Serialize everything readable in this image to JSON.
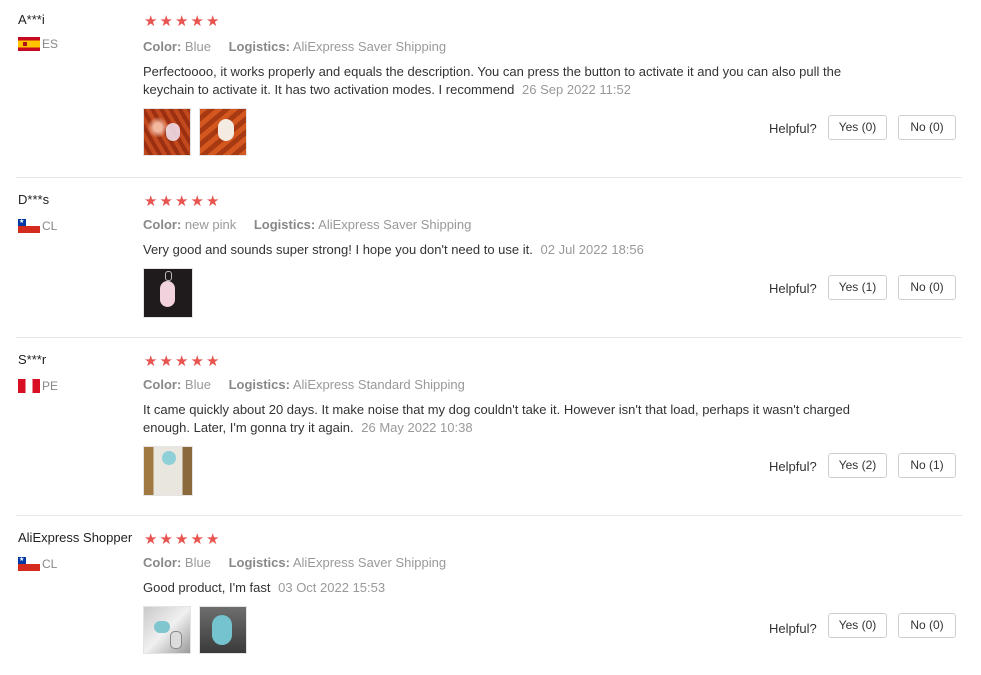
{
  "labels": {
    "color": "Color:",
    "logistics": "Logistics:",
    "helpful": "Helpful?"
  },
  "reviews": [
    {
      "name": "A***i",
      "country": "ES",
      "flag": "spain-flag-icon",
      "rating": 5,
      "color": "Blue",
      "logistics": "AliExpress Saver Shipping",
      "text": "Perfectoooo, it works properly and equals the description. You can press the button to activate it and you can also pull the keychain to activate it. It has two activation modes. I recommend",
      "date": "26 Sep 2022 11:52",
      "yes": "Yes (0)",
      "no": "No (0)"
    },
    {
      "name": "D***s",
      "country": "CL",
      "flag": "chile-flag-icon",
      "rating": 5,
      "color": "new pink",
      "logistics": "AliExpress Saver Shipping",
      "text": "Very good and sounds super strong! I hope you don't need to use it.",
      "date": "02 Jul 2022 18:56",
      "yes": "Yes (1)",
      "no": "No (0)"
    },
    {
      "name": "S***r",
      "country": "PE",
      "flag": "peru-flag-icon",
      "rating": 5,
      "color": "Blue",
      "logistics": "AliExpress Standard Shipping",
      "text": "It came quickly about 20 days. It make noise that my dog couldn't take it. However isn't that load, perhaps it wasn't charged enough. Later, I'm gonna try it again.",
      "date": "26 May 2022 10:38",
      "yes": "Yes (2)",
      "no": "No (1)"
    },
    {
      "name": "AliExpress Shopper",
      "country": "CL",
      "flag": "chile-flag-icon",
      "rating": 5,
      "color": "Blue",
      "logistics": "AliExpress Saver Shipping",
      "text": "Good product, I'm fast",
      "date": "03 Oct 2022 15:53",
      "yes": "Yes (0)",
      "no": "No (0)"
    }
  ],
  "colors": {
    "star": "#e85450",
    "muted_text": "#999999",
    "border": "#cfcfcf"
  }
}
